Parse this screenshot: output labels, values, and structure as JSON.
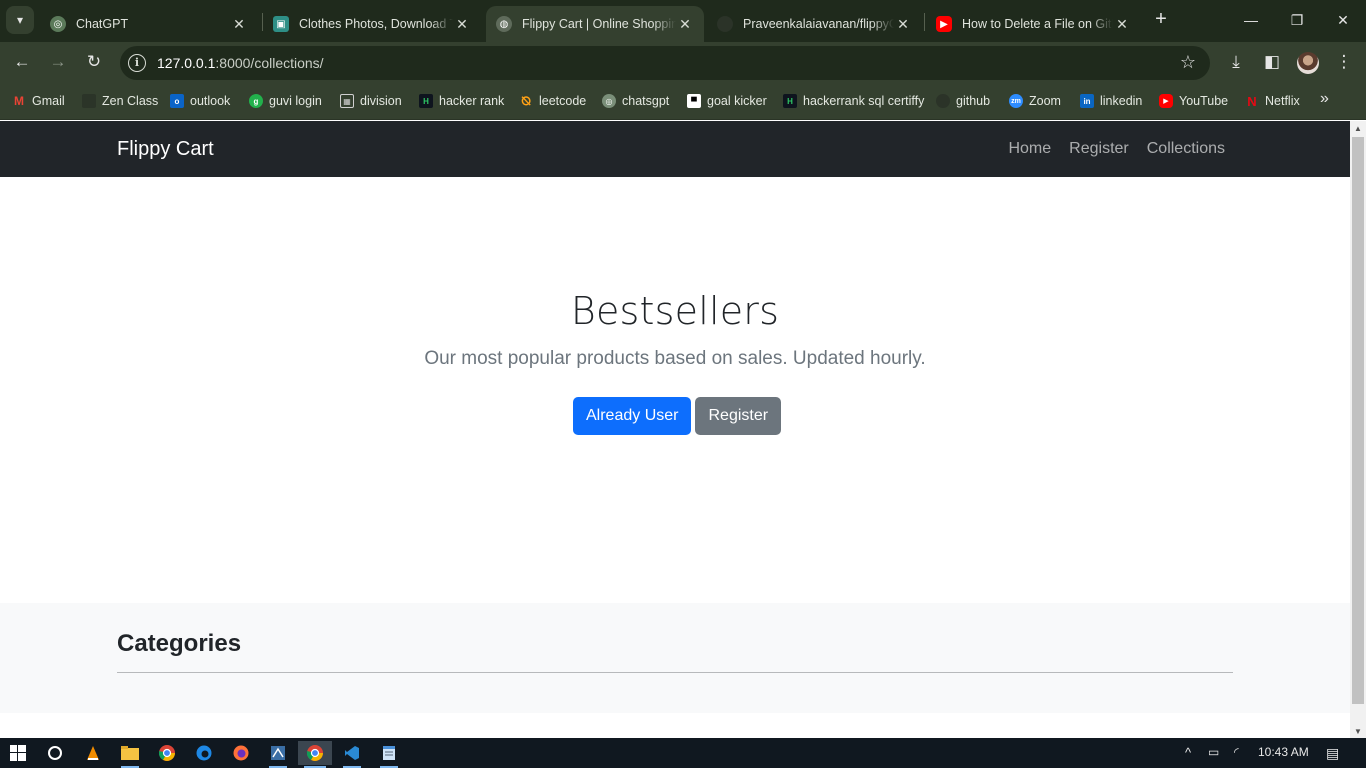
{
  "browser": {
    "tabs": [
      {
        "title": "ChatGPT",
        "icon": "chatgpt-icon",
        "active": false
      },
      {
        "title": "Clothes Photos, Download The",
        "icon": "unsplash-icon",
        "active": false
      },
      {
        "title": "Flippy Cart | Online Shopping",
        "icon": "globe-icon",
        "active": true
      },
      {
        "title": "Praveenkalaiavanan/flippyCa",
        "icon": "github-icon",
        "active": false
      },
      {
        "title": "How to Delete a File on GitH",
        "icon": "youtube-icon",
        "active": false
      }
    ],
    "url_host": "127.0.0.1",
    "url_path": ":8000/collections/",
    "bookmarks": [
      {
        "label": "Gmail",
        "icon": "gmail-icon"
      },
      {
        "label": "Zen Class",
        "icon": "zen-icon"
      },
      {
        "label": "outlook",
        "icon": "outlook-icon"
      },
      {
        "label": "guvi login",
        "icon": "guvi-icon"
      },
      {
        "label": "division",
        "icon": "calculator-icon"
      },
      {
        "label": "hacker rank",
        "icon": "hackerrank-icon"
      },
      {
        "label": "leetcode",
        "icon": "leetcode-icon"
      },
      {
        "label": "chatsgpt",
        "icon": "chatgpt-icon"
      },
      {
        "label": "goal kicker",
        "icon": "goalkicker-icon"
      },
      {
        "label": "hackerrank sql certiffy",
        "icon": "hackerrank-icon"
      },
      {
        "label": "github",
        "icon": "github-icon"
      },
      {
        "label": "Zoom",
        "icon": "zoom-icon"
      },
      {
        "label": "linkedin",
        "icon": "linkedin-icon"
      },
      {
        "label": "YouTube",
        "icon": "youtube-icon"
      },
      {
        "label": "Netflix",
        "icon": "netflix-icon"
      }
    ]
  },
  "site": {
    "brand": "Flippy Cart",
    "nav": [
      "Home",
      "Register",
      "Collections"
    ],
    "hero": {
      "title": "Bestsellers",
      "lead": "Our most popular products based on sales. Updated hourly.",
      "primary_button": "Already User",
      "secondary_button": "Register"
    },
    "categories_heading": "Categories"
  },
  "taskbar": {
    "time": "10:43 AM"
  },
  "colors": {
    "navbar": "#212529",
    "primary": "#0d6efd",
    "secondary": "#6c757d",
    "chrome_frame": "#1f2a1c",
    "chrome_toolbar": "#34402f"
  }
}
